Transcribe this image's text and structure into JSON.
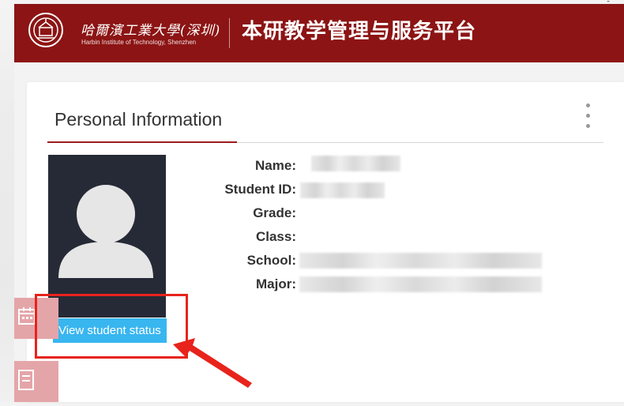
{
  "header": {
    "university_name_cn": "哈爾濱工業大學(深圳)",
    "university_name_en": "Harbin Institute of Technology, Shenzhen",
    "platform_title": "本研教学管理与服务平台",
    "brand_color": "#8c1414"
  },
  "panel": {
    "title": "Personal Information",
    "menu_icon": "kebab-menu-icon"
  },
  "profile": {
    "avatar_icon": "default-user-avatar-icon",
    "view_status_label": "View student status",
    "button_color": "#38b6f0"
  },
  "info_fields": [
    {
      "label": "Name:",
      "value_redacted": true
    },
    {
      "label": "Student ID:",
      "value_redacted": true
    },
    {
      "label": "Grade:",
      "value_redacted": false
    },
    {
      "label": "Class:",
      "value_redacted": false
    },
    {
      "label": "School:",
      "value_redacted": true
    },
    {
      "label": "Major:",
      "value_redacted": true
    }
  ],
  "sidebar": {
    "buttons": [
      {
        "icon": "calendar-icon"
      },
      {
        "icon": "document-icon"
      }
    ],
    "button_color": "#e4a5a9"
  },
  "annotation": {
    "color": "#e8231c",
    "shape": "rectangle-with-arrow"
  }
}
